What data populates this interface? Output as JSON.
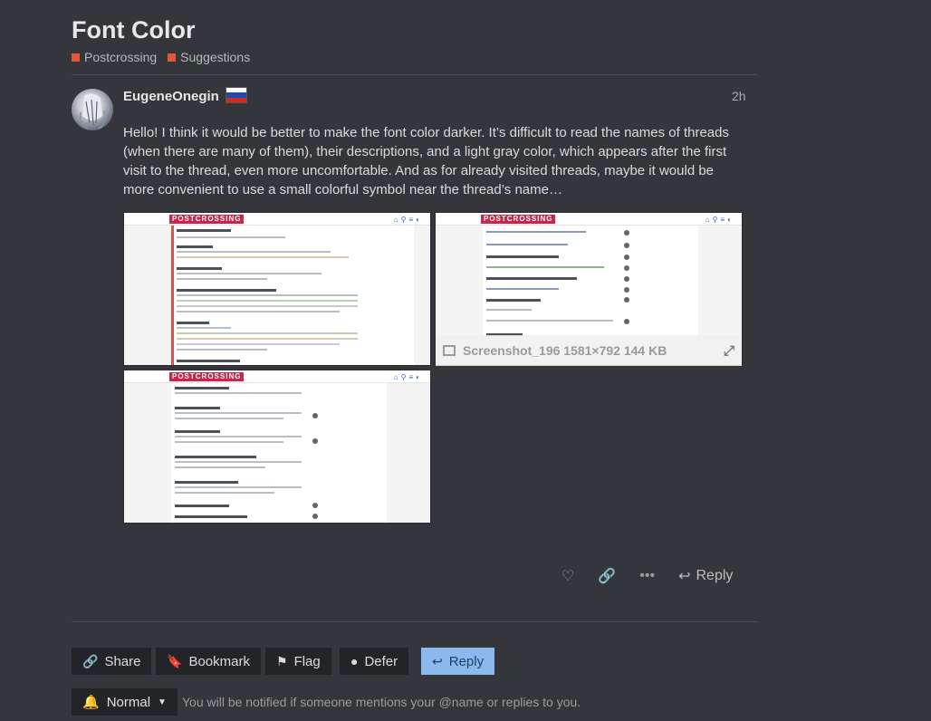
{
  "topic": {
    "title": "Font Color",
    "categories": [
      {
        "label": "Postcrossing",
        "color": "#e45735"
      },
      {
        "label": "Suggestions",
        "color": "#e45735"
      }
    ]
  },
  "post": {
    "username": "EugeneOnegin",
    "time": "2h",
    "body": "Hello! I think it would be better to make the font color darker. It’s difficult to read the names of threads (when there are many of them), their descriptions, and a light gray color, which appears after the first visit to the thread, even more uncomfortable. And as for already visited threads, maybe it would be more convenient to use a small colorful symbol near the thread’s name…",
    "screenshots": {
      "logo_text": "POSTCROSSING",
      "caption": "Screenshot_196 1581×792 144 KB"
    },
    "actions": {
      "reply_label": "Reply"
    }
  },
  "footer_buttons": {
    "share": "Share",
    "bookmark": "Bookmark",
    "flag": "Flag",
    "defer": "Defer",
    "reply": "Reply"
  },
  "notifications": {
    "level": "Normal",
    "description": "You will be notified if someone mentions your @name or replies to you."
  },
  "colors": {
    "accent": "#8bb8ef",
    "category": "#e45735",
    "background": "#34363b"
  }
}
